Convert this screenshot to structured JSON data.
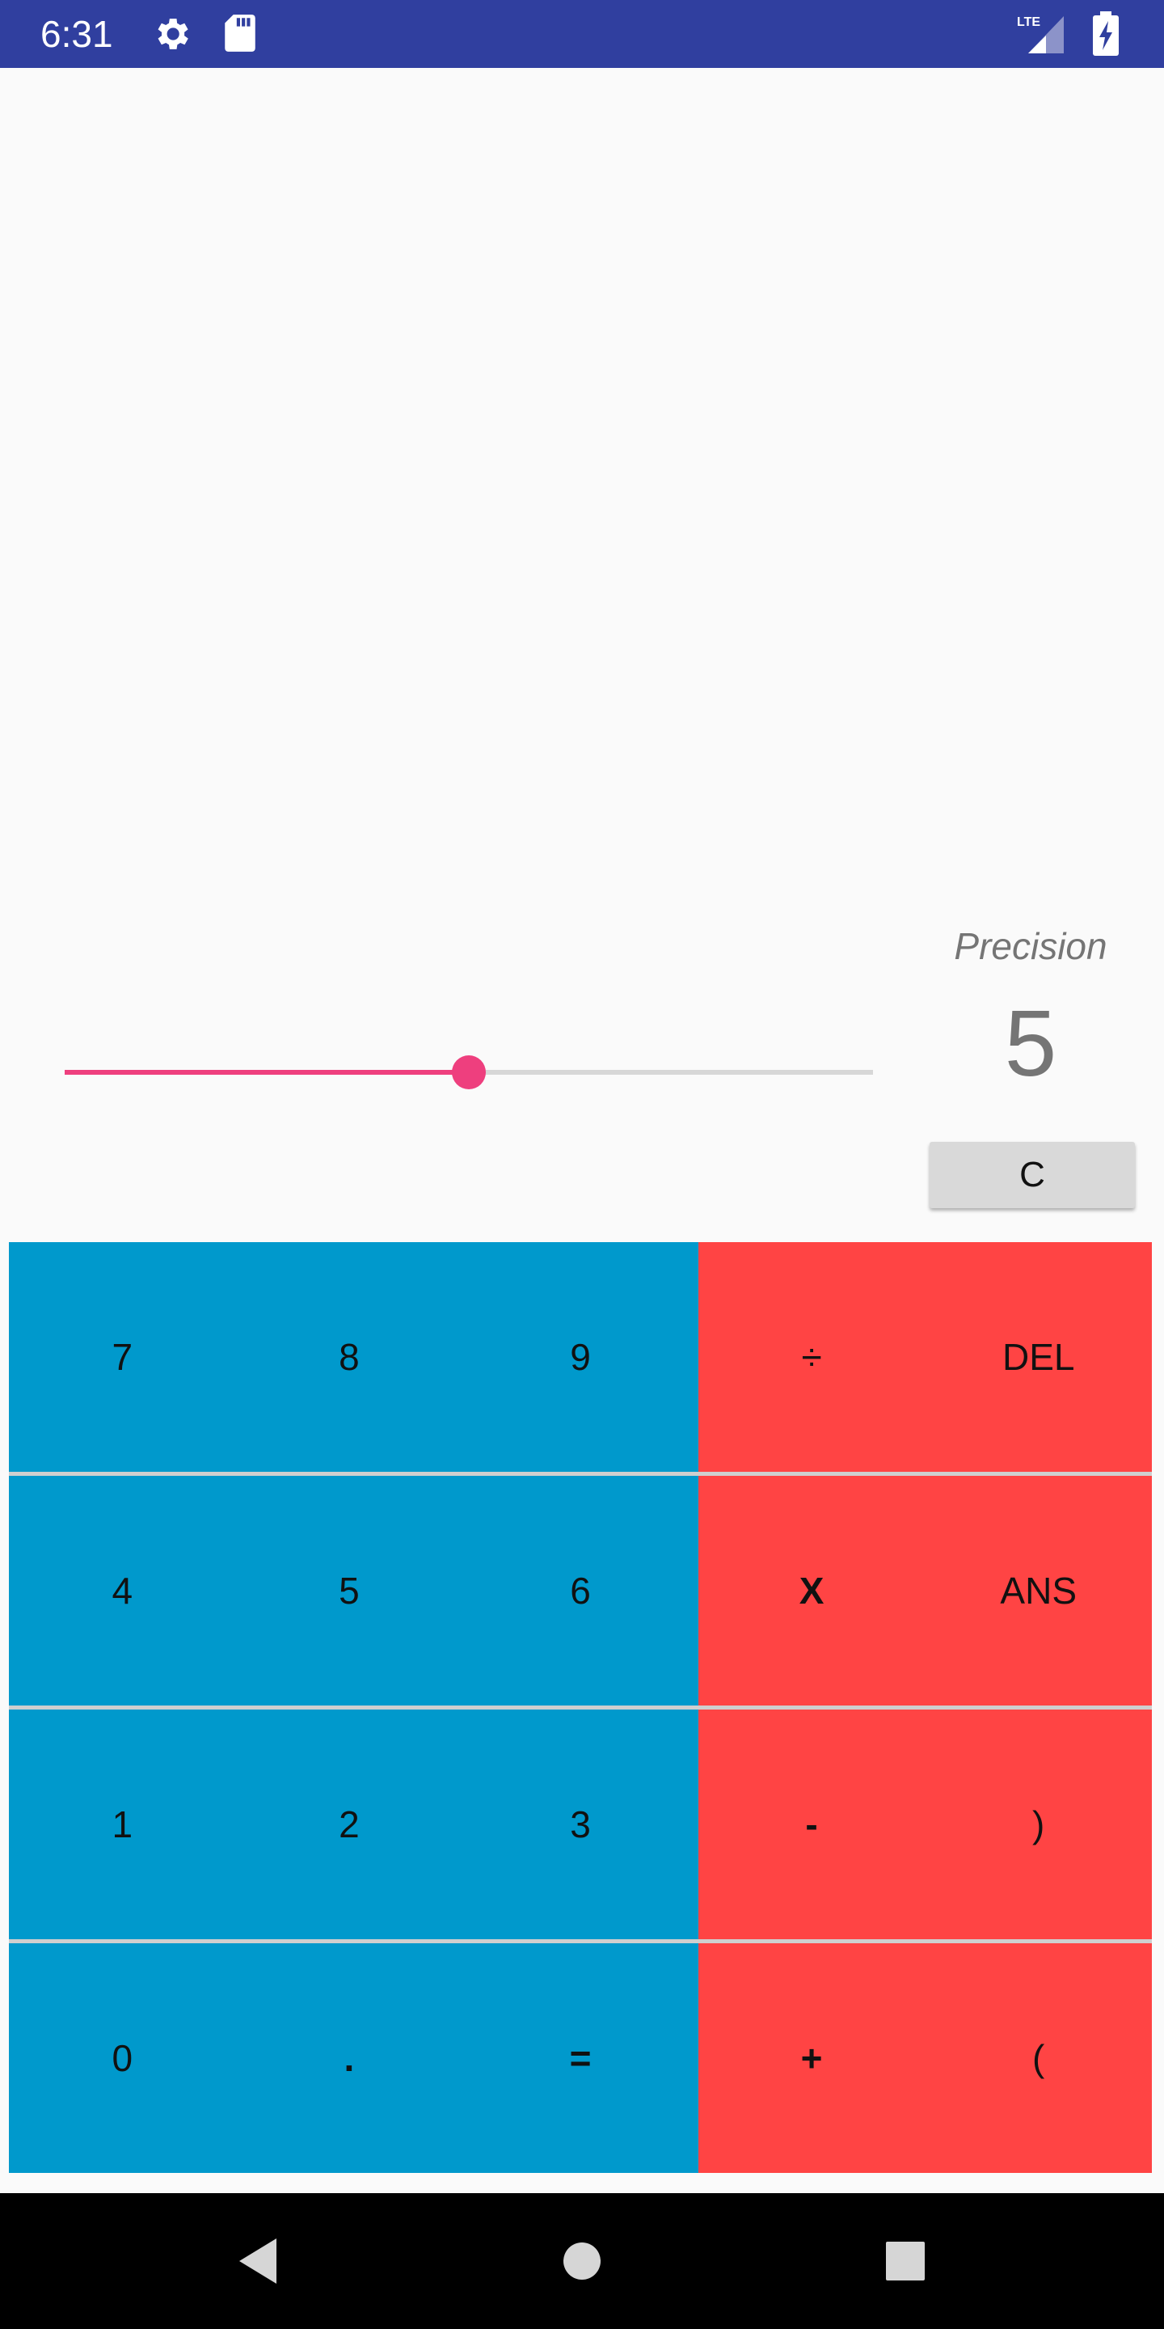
{
  "status_bar": {
    "time": "6:31",
    "network": "LTE",
    "icons": [
      "gear-icon",
      "sd-card-icon",
      "lte-signal-icon",
      "battery-charging-icon"
    ],
    "background_color": "#303f9f"
  },
  "precision": {
    "label": "Precision",
    "value": "5",
    "slider_fraction": 0.5
  },
  "clear_button": {
    "label": "C"
  },
  "keypad": {
    "number_color": "#0099cc",
    "operator_color": "#ff4444",
    "rows": [
      {
        "keys": [
          "7",
          "8",
          "9",
          "÷",
          "DEL"
        ]
      },
      {
        "keys": [
          "4",
          "5",
          "6",
          "X",
          "ANS"
        ]
      },
      {
        "keys": [
          "1",
          "2",
          "3",
          "-",
          ")"
        ]
      },
      {
        "keys": [
          "0",
          ".",
          "=",
          "+",
          "("
        ]
      }
    ]
  },
  "nav_bar": {
    "icons": [
      "back-icon",
      "home-icon",
      "recents-icon"
    ]
  }
}
